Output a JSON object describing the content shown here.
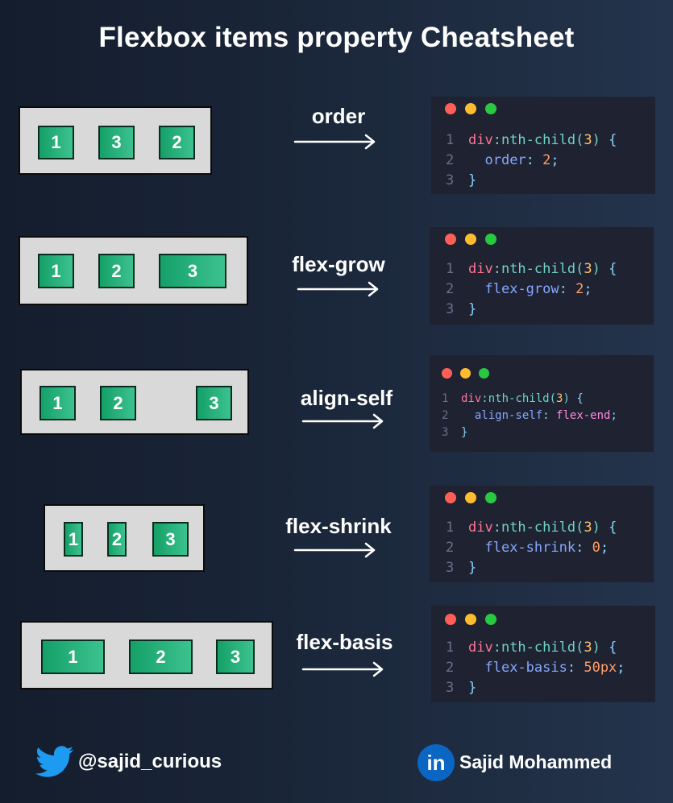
{
  "title": "Flexbox items property Cheatsheet",
  "rows": [
    {
      "label": "order",
      "items": [
        "1",
        "3",
        "2"
      ],
      "code": {
        "l1": "1",
        "l2": "2",
        "l3": "3",
        "selector": "div",
        "pseudo": ":nth-child(",
        "arg": "3",
        "close": ")",
        "open_brace": "{",
        "prop": "order",
        "colon": ":",
        "value": "2",
        "semi": ";",
        "close_brace": "}"
      }
    },
    {
      "label": "flex-grow",
      "items": [
        "1",
        "2",
        "3"
      ],
      "code": {
        "l1": "1",
        "l2": "2",
        "l3": "3",
        "selector": "div",
        "pseudo": ":nth-child(",
        "arg": "3",
        "close": ")",
        "open_brace": "{",
        "prop": "flex-grow",
        "colon": ":",
        "value": "2",
        "semi": ";",
        "close_brace": "}"
      }
    },
    {
      "label": "align-self",
      "items": [
        "1",
        "2",
        "3"
      ],
      "code": {
        "l1": "1",
        "l2": "2",
        "l3": "3",
        "selector": "div",
        "pseudo": ":nth-child(",
        "arg": "3",
        "close": ")",
        "open_brace": "{",
        "prop": "align-self",
        "colon": ":",
        "value": "flex-end",
        "semi": ";",
        "close_brace": "}"
      }
    },
    {
      "label": "flex-shrink",
      "items": [
        "1",
        "2",
        "3"
      ],
      "code": {
        "l1": "1",
        "l2": "2",
        "l3": "3",
        "selector": "div",
        "pseudo": ":nth-child(",
        "arg": "3",
        "close": ")",
        "open_brace": "{",
        "prop": "flex-shrink",
        "colon": ":",
        "value": "0",
        "semi": ";",
        "close_brace": "}"
      }
    },
    {
      "label": "flex-basis",
      "items": [
        "1",
        "2",
        "3"
      ],
      "code": {
        "l1": "1",
        "l2": "2",
        "l3": "3",
        "selector": "div",
        "pseudo": ":nth-child(",
        "arg": "3",
        "close": ")",
        "open_brace": "{",
        "prop": "flex-basis",
        "colon": ":",
        "value": "50px",
        "semi": ";",
        "close_brace": "}"
      }
    }
  ],
  "footer": {
    "twitter_handle": "@sajid_curious",
    "linkedin_name": "Sajid Mohammed",
    "linkedin_logo_text": "in",
    "icons": {
      "twitter": "twitter-bird-icon",
      "linkedin": "linkedin-icon"
    }
  },
  "colors": {
    "item_start": "#15a068",
    "item_end": "#3cc28f",
    "code_bg": "#1f2231",
    "twitter_blue": "#1d9bf0",
    "linkedin_blue": "#0a66c2"
  }
}
